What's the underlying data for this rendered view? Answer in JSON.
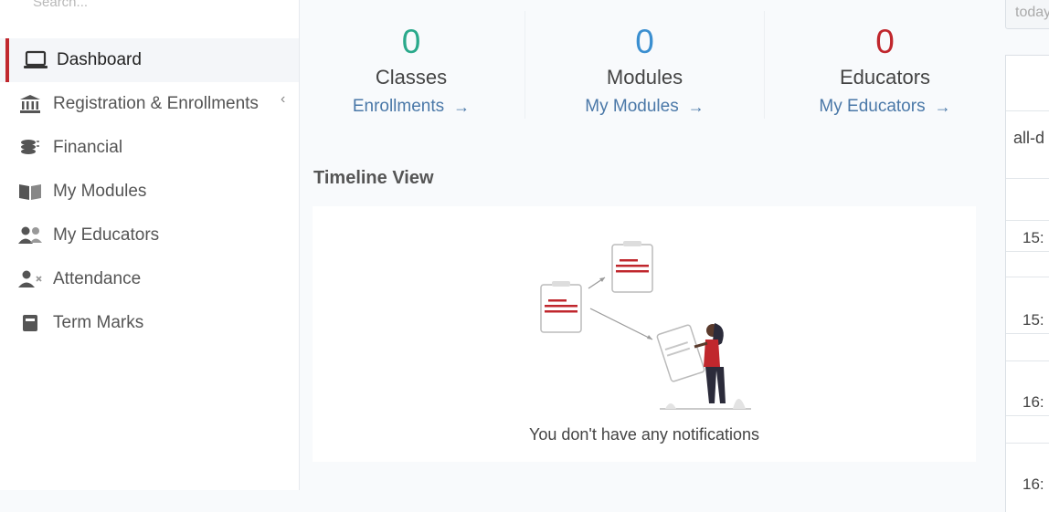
{
  "sidebar": {
    "search_placeholder": "Search...",
    "items": [
      {
        "label": "Dashboard",
        "icon": "laptop-icon",
        "active": true
      },
      {
        "label": "Registration & Enrollments",
        "icon": "bank-icon"
      },
      {
        "label": "Financial",
        "icon": "coins-icon"
      },
      {
        "label": "My Modules",
        "icon": "book-icon"
      },
      {
        "label": "My Educators",
        "icon": "users-icon"
      },
      {
        "label": "Attendance",
        "icon": "user-x-icon"
      },
      {
        "label": "Term Marks",
        "icon": "book-closed-icon"
      }
    ],
    "expand_chevron": "‹"
  },
  "stats": [
    {
      "value": "0",
      "label": "Classes",
      "link": "Enrollments",
      "color": "#2aa98b"
    },
    {
      "value": "0",
      "label": "Modules",
      "link": "My Modules",
      "color": "#3b8fd0"
    },
    {
      "value": "0",
      "label": "Educators",
      "link": "My Educators",
      "color": "#c0272d"
    }
  ],
  "arrow": "→",
  "timeline": {
    "title": "Timeline View",
    "empty_message": "You don't have any notifications"
  },
  "calendar": {
    "today_label": "today",
    "allday_label": "all-d",
    "times": [
      "15:",
      "15:",
      "16:",
      "16:"
    ]
  },
  "colors": {
    "accent": "#c0272d",
    "link": "#4a78a8"
  }
}
